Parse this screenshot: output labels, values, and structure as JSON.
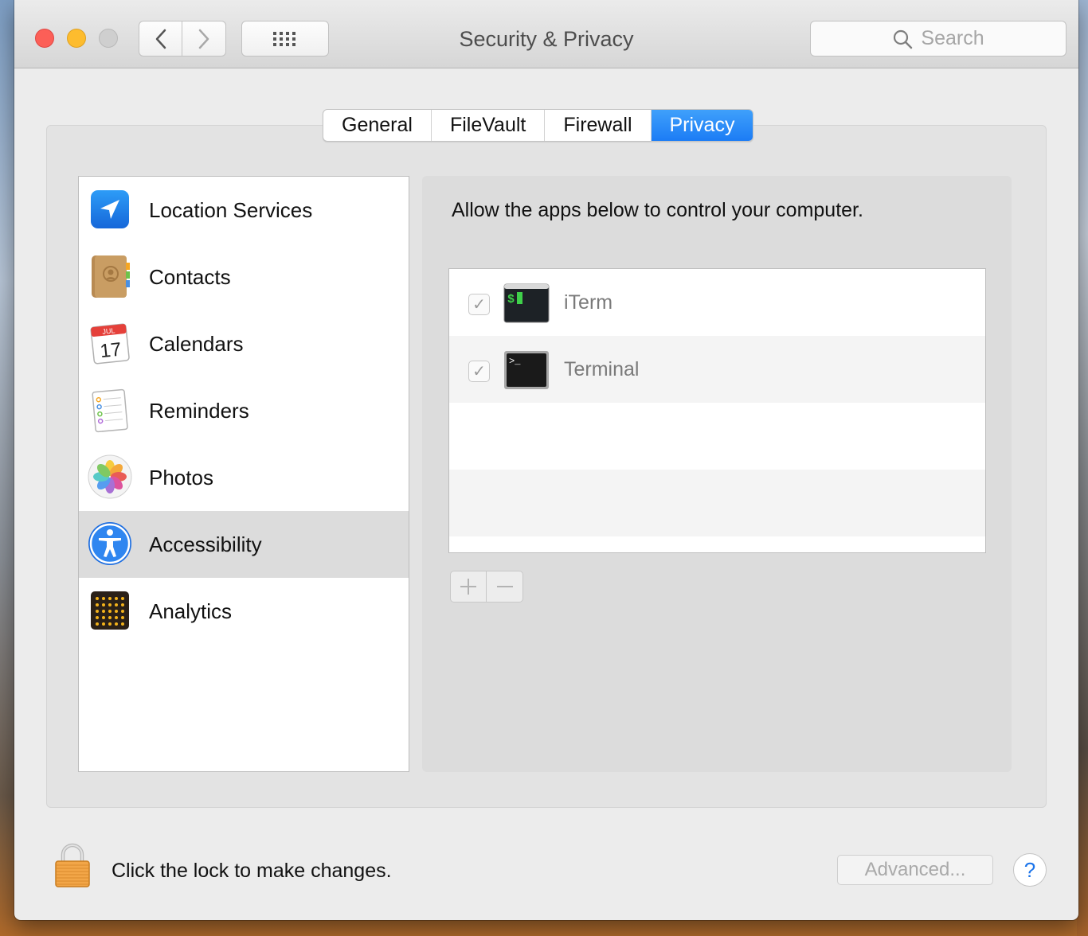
{
  "window": {
    "title": "Security & Privacy"
  },
  "toolbar": {
    "back_icon": "chevron-left-icon",
    "forward_icon": "chevron-right-icon",
    "show_all_icon": "grid-icon",
    "search_placeholder": "Search"
  },
  "tabs": [
    {
      "label": "General",
      "active": false
    },
    {
      "label": "FileVault",
      "active": false
    },
    {
      "label": "Firewall",
      "active": false
    },
    {
      "label": "Privacy",
      "active": true
    }
  ],
  "categories": [
    {
      "label": "Location Services",
      "icon": "location-arrow-icon",
      "selected": false
    },
    {
      "label": "Contacts",
      "icon": "contacts-book-icon",
      "selected": false
    },
    {
      "label": "Calendars",
      "icon": "calendar-icon",
      "selected": false,
      "icon_month": "JUL",
      "icon_day": "17"
    },
    {
      "label": "Reminders",
      "icon": "reminders-list-icon",
      "selected": false
    },
    {
      "label": "Photos",
      "icon": "photos-flower-icon",
      "selected": false
    },
    {
      "label": "Accessibility",
      "icon": "accessibility-person-icon",
      "selected": true
    },
    {
      "label": "Analytics",
      "icon": "analytics-grid-icon",
      "selected": false
    }
  ],
  "pane": {
    "heading": "Allow the apps below to control your computer.",
    "apps": [
      {
        "name": "iTerm",
        "checked": true,
        "icon": "iterm-icon",
        "icon_glyph": "$"
      },
      {
        "name": "Terminal",
        "checked": true,
        "icon": "terminal-icon",
        "icon_glyph": ">_"
      }
    ],
    "add_icon": "plus-icon",
    "remove_icon": "minus-icon"
  },
  "footer": {
    "lock_text": "Click the lock to make changes.",
    "advanced_label": "Advanced...",
    "help_label": "?"
  },
  "colors": {
    "accent": "#1c7cf5",
    "close": "#fc5f57",
    "minimize": "#fdbc2e",
    "zoom_disabled": "#cfcfcf"
  }
}
